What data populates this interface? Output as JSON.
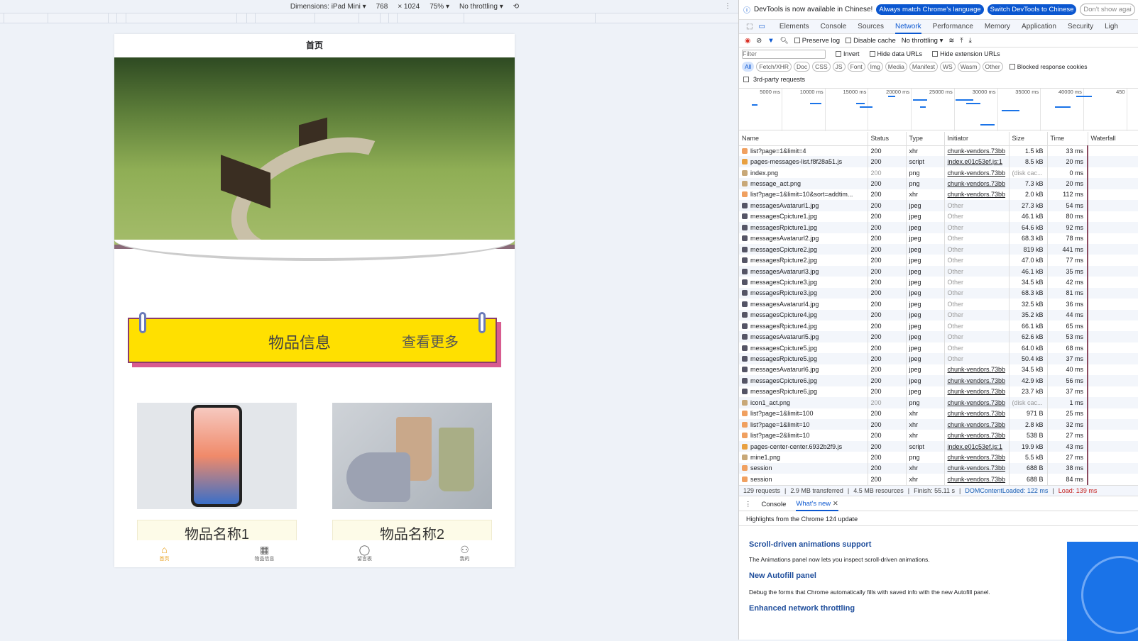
{
  "device_toolbar": {
    "dimensions": "Dimensions: iPad Mini ▾",
    "width": "768",
    "height": "× 1024",
    "zoom": "75% ▾",
    "throttling": "No throttling ▾"
  },
  "app": {
    "title": "首页",
    "section_title": "物品信息",
    "section_more": "查看更多",
    "items": [
      {
        "name": "物品名称1"
      },
      {
        "name": "物品名称2"
      }
    ],
    "tabbar": [
      {
        "label": "首页",
        "icon": "home-icon",
        "active": true
      },
      {
        "label": "物品信息",
        "icon": "grid-icon"
      },
      {
        "label": "留言板",
        "icon": "chat-icon"
      },
      {
        "label": "我的",
        "icon": "user-icon"
      }
    ],
    "accent": "#ffe000"
  },
  "devtools": {
    "banner": {
      "text": "DevTools is now available in Chinese!",
      "btn1": "Always match Chrome's language",
      "btn2": "Switch DevTools to Chinese",
      "btn3": "Don't show agai"
    },
    "tabs": [
      "Elements",
      "Console",
      "Sources",
      "Network",
      "Performance",
      "Memory",
      "Application",
      "Security",
      "Ligh"
    ],
    "active_tab": "Network",
    "toolbar": {
      "preserve_log": "Preserve log",
      "disable_cache": "Disable cache",
      "throttling": "No throttling"
    },
    "filter": {
      "placeholder": "Filter",
      "invert": "Invert",
      "hide_data": "Hide data URLs",
      "hide_ext": "Hide extension URLs",
      "blocked": "Blocked response cookies",
      "third_party": "3rd-party requests"
    },
    "chips": [
      "All",
      "Fetch/XHR",
      "Doc",
      "CSS",
      "JS",
      "Font",
      "Img",
      "Media",
      "Manifest",
      "WS",
      "Wasm",
      "Other"
    ],
    "timeline_ticks": [
      "5000 ms",
      "10000 ms",
      "15000 ms",
      "20000 ms",
      "25000 ms",
      "30000 ms",
      "35000 ms",
      "40000 ms",
      "450"
    ],
    "columns": [
      "Name",
      "Status",
      "Type",
      "Initiator",
      "Size",
      "Time",
      "Waterfall"
    ],
    "rows": [
      [
        "list?page=1&limit=4",
        "200",
        "xhr",
        "chunk-vendors.73bb",
        "1.5 kB",
        "33 ms"
      ],
      [
        "pages-messages-list.f8f28a51.js",
        "200",
        "script",
        "index.e01c53ef.js:1",
        "8.5 kB",
        "20 ms"
      ],
      [
        "index.png",
        "200",
        "png",
        "chunk-vendors.73bb",
        "(disk cac...",
        "0 ms"
      ],
      [
        "message_act.png",
        "200",
        "png",
        "chunk-vendors.73bb",
        "7.3 kB",
        "20 ms"
      ],
      [
        "list?page=1&limit=10&sort=addtim...",
        "200",
        "xhr",
        "chunk-vendors.73bb",
        "2.0 kB",
        "112 ms"
      ],
      [
        "messagesAvatarurl1.jpg",
        "200",
        "jpeg",
        "Other",
        "27.3 kB",
        "54 ms"
      ],
      [
        "messagesCpicture1.jpg",
        "200",
        "jpeg",
        "Other",
        "46.1 kB",
        "80 ms"
      ],
      [
        "messagesRpicture1.jpg",
        "200",
        "jpeg",
        "Other",
        "64.6 kB",
        "92 ms"
      ],
      [
        "messagesAvatarurl2.jpg",
        "200",
        "jpeg",
        "Other",
        "68.3 kB",
        "78 ms"
      ],
      [
        "messagesCpicture2.jpg",
        "200",
        "jpeg",
        "Other",
        "819 kB",
        "441 ms"
      ],
      [
        "messagesRpicture2.jpg",
        "200",
        "jpeg",
        "Other",
        "47.0 kB",
        "77 ms"
      ],
      [
        "messagesAvatarurl3.jpg",
        "200",
        "jpeg",
        "Other",
        "46.1 kB",
        "35 ms"
      ],
      [
        "messagesCpicture3.jpg",
        "200",
        "jpeg",
        "Other",
        "34.5 kB",
        "42 ms"
      ],
      [
        "messagesRpicture3.jpg",
        "200",
        "jpeg",
        "Other",
        "68.3 kB",
        "81 ms"
      ],
      [
        "messagesAvatarurl4.jpg",
        "200",
        "jpeg",
        "Other",
        "32.5 kB",
        "36 ms"
      ],
      [
        "messagesCpicture4.jpg",
        "200",
        "jpeg",
        "Other",
        "35.2 kB",
        "44 ms"
      ],
      [
        "messagesRpicture4.jpg",
        "200",
        "jpeg",
        "Other",
        "66.1 kB",
        "65 ms"
      ],
      [
        "messagesAvatarurl5.jpg",
        "200",
        "jpeg",
        "Other",
        "62.6 kB",
        "53 ms"
      ],
      [
        "messagesCpicture5.jpg",
        "200",
        "jpeg",
        "Other",
        "64.0 kB",
        "68 ms"
      ],
      [
        "messagesRpicture5.jpg",
        "200",
        "jpeg",
        "Other",
        "50.4 kB",
        "37 ms"
      ],
      [
        "messagesAvatarurl6.jpg",
        "200",
        "jpeg",
        "chunk-vendors.73bb",
        "34.5 kB",
        "40 ms"
      ],
      [
        "messagesCpicture6.jpg",
        "200",
        "jpeg",
        "chunk-vendors.73bb",
        "42.9 kB",
        "56 ms"
      ],
      [
        "messagesRpicture6.jpg",
        "200",
        "jpeg",
        "chunk-vendors.73bb",
        "23.7 kB",
        "37 ms"
      ],
      [
        "icon1_act.png",
        "200",
        "png",
        "chunk-vendors.73bb",
        "(disk cac...",
        "1 ms"
      ],
      [
        "list?page=1&limit=100",
        "200",
        "xhr",
        "chunk-vendors.73bb",
        "971 B",
        "25 ms"
      ],
      [
        "list?page=1&limit=10",
        "200",
        "xhr",
        "chunk-vendors.73bb",
        "2.8 kB",
        "32 ms"
      ],
      [
        "list?page=2&limit=10",
        "200",
        "xhr",
        "chunk-vendors.73bb",
        "538 B",
        "27 ms"
      ],
      [
        "pages-center-center.6932b2f9.js",
        "200",
        "script",
        "index.e01c53ef.js:1",
        "19.9 kB",
        "43 ms"
      ],
      [
        "mine1.png",
        "200",
        "png",
        "chunk-vendors.73bb",
        "5.5 kB",
        "27 ms"
      ],
      [
        "session",
        "200",
        "xhr",
        "chunk-vendors.73bb",
        "688 B",
        "38 ms"
      ],
      [
        "session",
        "200",
        "xhr",
        "chunk-vendors.73bb",
        "688 B",
        "84 ms"
      ]
    ],
    "summary": {
      "requests": "129 requests",
      "transferred": "2.9 MB transferred",
      "resources": "4.5 MB resources",
      "finish": "Finish: 55.11 s",
      "dcl": "DOMContentLoaded: 122 ms",
      "load": "Load: 139 ms"
    },
    "drawer": {
      "console": "Console",
      "whats_new": "What's new"
    },
    "whats_new": {
      "header": "Highlights from the Chrome 124 update",
      "items": [
        {
          "title": "Scroll-driven animations support",
          "desc": "The Animations panel now lets you inspect scroll-driven animations."
        },
        {
          "title": "New Autofill panel",
          "desc": "Debug the forms that Chrome automatically fills with saved info with the new Autofill panel."
        },
        {
          "title": "Enhanced network throttling",
          "desc": ""
        }
      ]
    }
  }
}
